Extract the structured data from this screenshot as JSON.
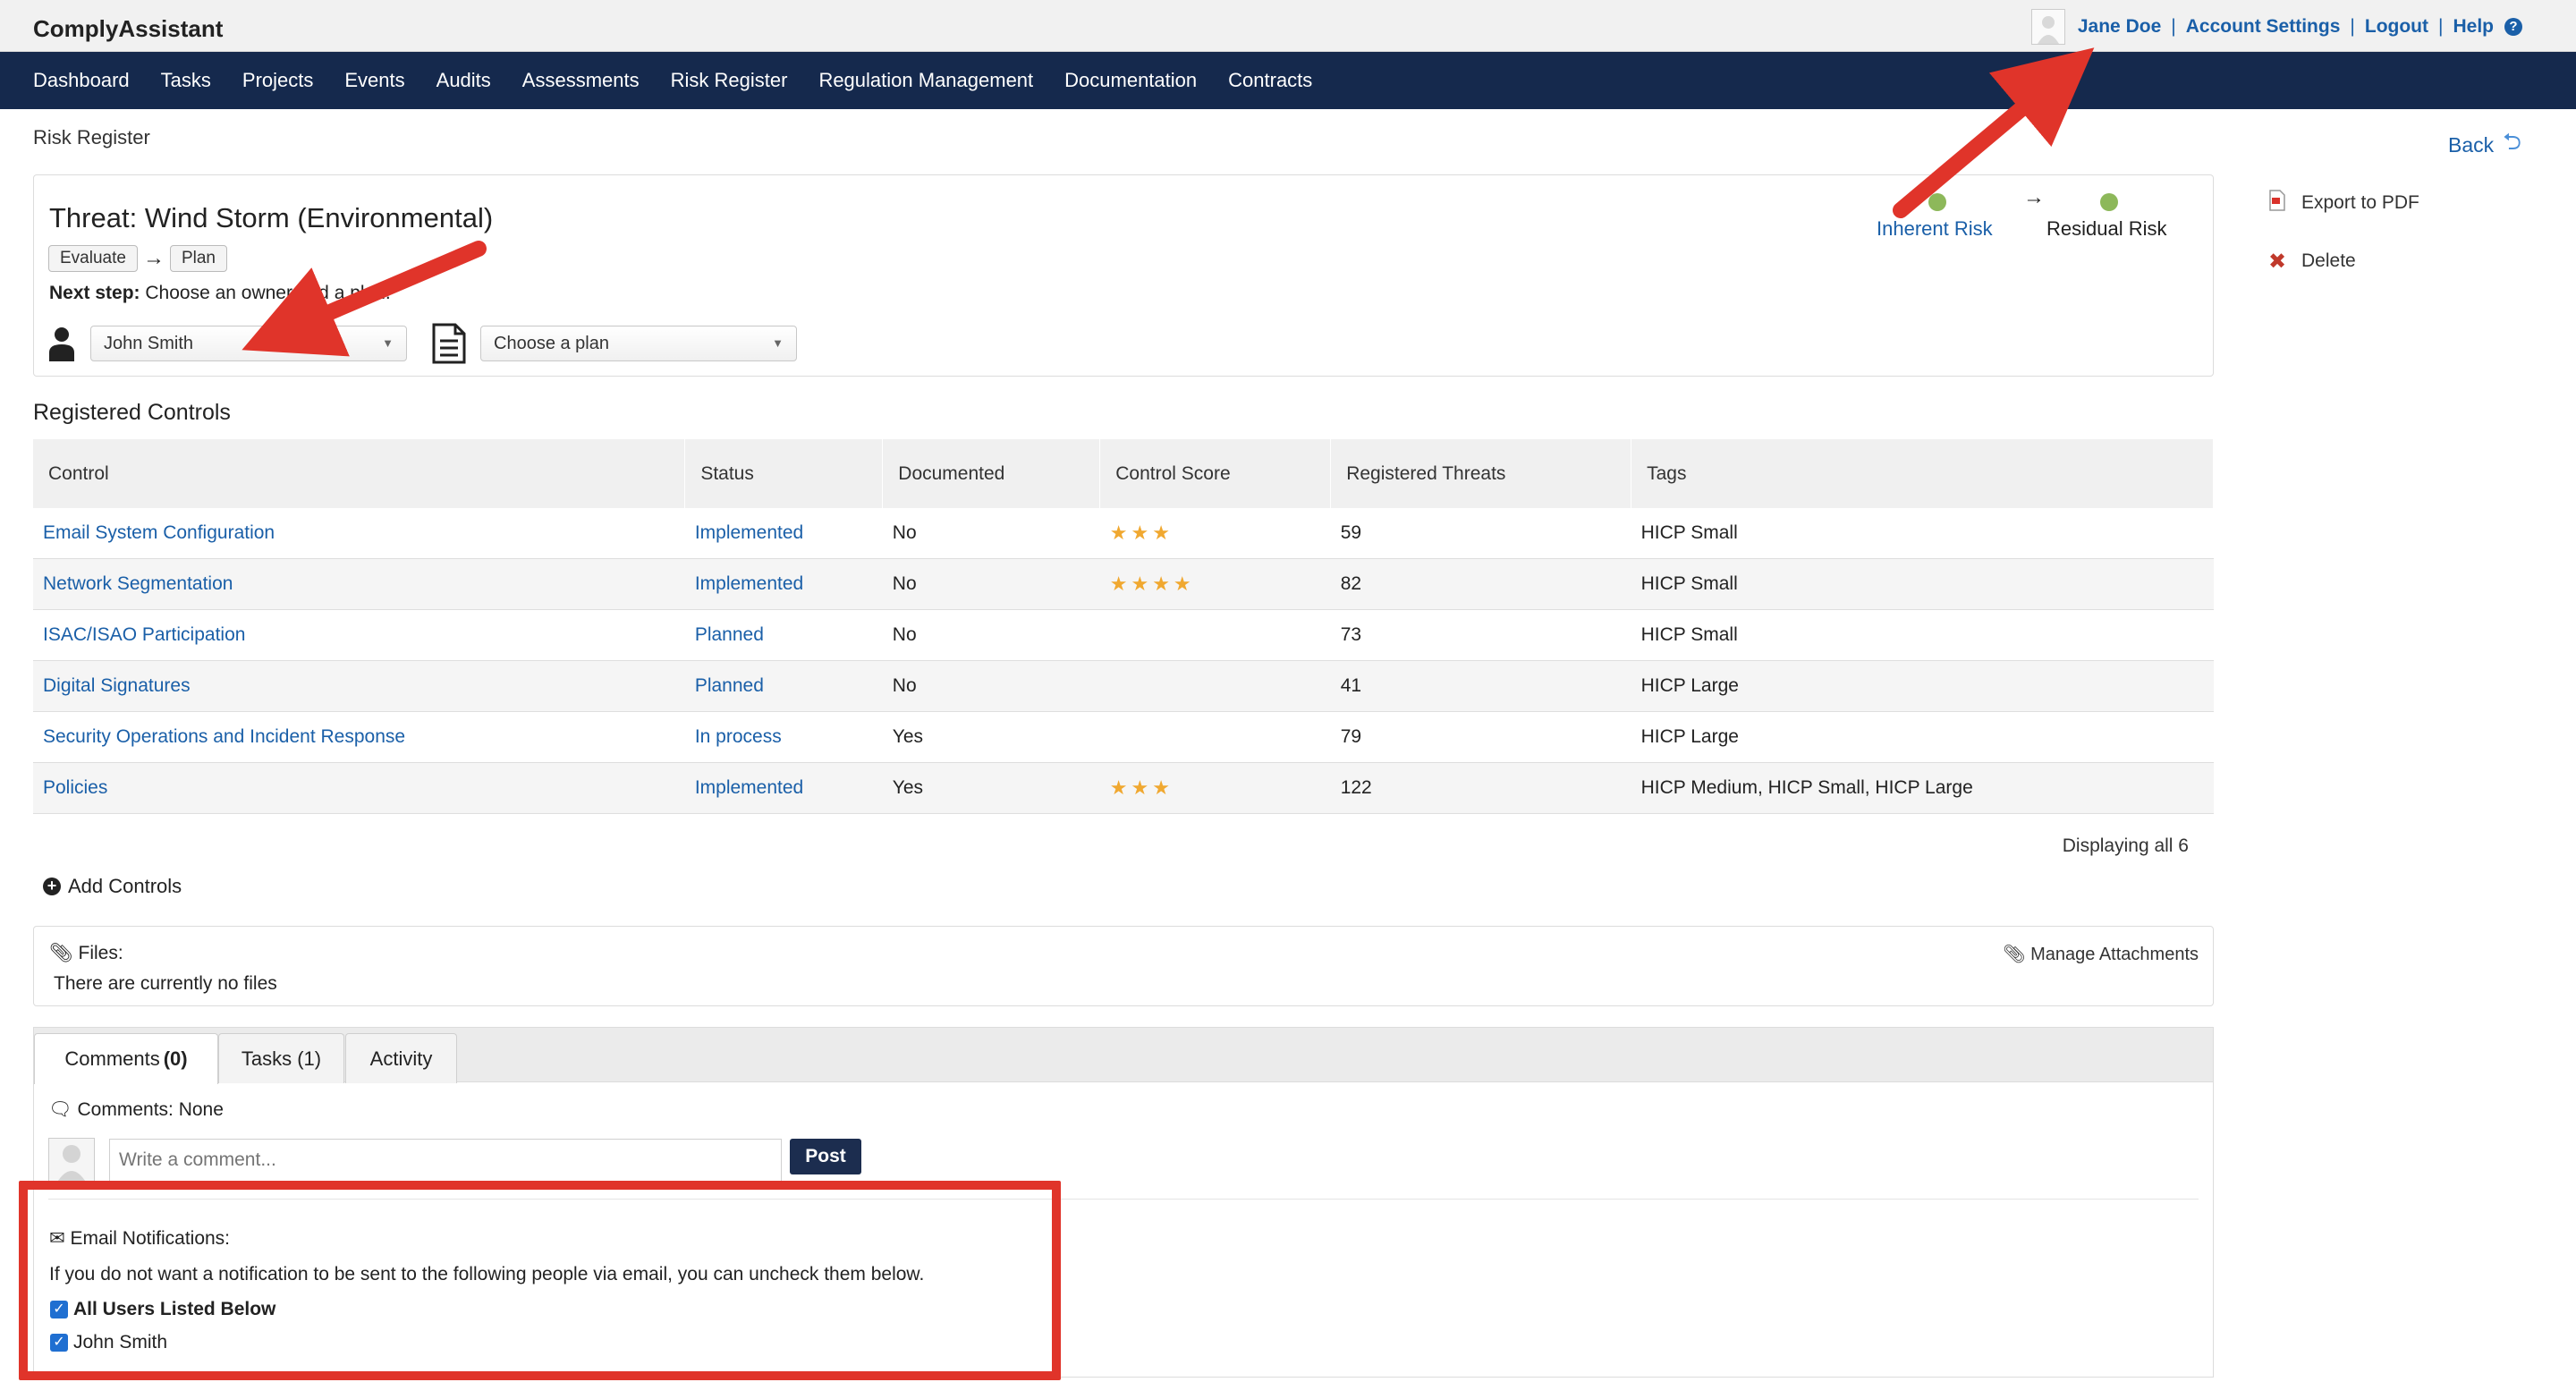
{
  "app": {
    "title": "ComplyAssistant"
  },
  "user": {
    "name": "Jane Doe",
    "links": [
      "Account Settings",
      "Logout",
      "Help"
    ]
  },
  "nav": [
    "Dashboard",
    "Tasks",
    "Projects",
    "Events",
    "Audits",
    "Assessments",
    "Risk Register",
    "Regulation Management",
    "Documentation",
    "Contracts"
  ],
  "breadcrumb": "Risk Register",
  "back_label": "Back",
  "threat": {
    "title": "Threat: Wind Storm (Environmental)",
    "steps": [
      "Evaluate",
      "Plan"
    ],
    "next_step_label": "Next step:",
    "next_step_text": "Choose an owner and a plan.",
    "owner_value": "John Smith",
    "plan_placeholder": "Choose a plan",
    "inherent_risk": "Inherent Risk",
    "residual_risk": "Residual Risk"
  },
  "side_actions": {
    "export": "Export to PDF",
    "delete": "Delete"
  },
  "controls": {
    "section_title": "Registered Controls",
    "columns": [
      "Control",
      "Status",
      "Documented",
      "Control Score",
      "Registered Threats",
      "Tags"
    ],
    "rows": [
      {
        "name": "Email System Configuration",
        "status": "Implemented",
        "documented": "No",
        "score": 3,
        "threats": "59",
        "tags": "HICP Small"
      },
      {
        "name": "Network Segmentation",
        "status": "Implemented",
        "documented": "No",
        "score": 4,
        "threats": "82",
        "tags": "HICP Small"
      },
      {
        "name": "ISAC/ISAO Participation",
        "status": "Planned",
        "documented": "No",
        "score": 0,
        "threats": "73",
        "tags": "HICP Small"
      },
      {
        "name": "Digital Signatures",
        "status": "Planned",
        "documented": "No",
        "score": 0,
        "threats": "41",
        "tags": "HICP Large"
      },
      {
        "name": "Security Operations and Incident Response",
        "status": "In process",
        "documented": "Yes",
        "score": 0,
        "threats": "79",
        "tags": "HICP Large"
      },
      {
        "name": "Policies",
        "status": "Implemented",
        "documented": "Yes",
        "score": 3,
        "threats": "122",
        "tags": "HICP Medium, HICP Small, HICP Large"
      }
    ],
    "displaying": "Displaying all 6",
    "add_label": "Add Controls"
  },
  "files": {
    "label": "Files:",
    "empty": "There are currently no files",
    "manage": "Manage Attachments"
  },
  "tabs": [
    {
      "label": "Comments",
      "count": "(0)"
    },
    {
      "label": "Tasks (1)"
    },
    {
      "label": "Activity"
    }
  ],
  "comments": {
    "label": "Comments: None",
    "placeholder": "Write a comment...",
    "post": "Post"
  },
  "notifications": {
    "title": "Email Notifications:",
    "text": "If you do not want a notification to be sent to the following people via email, you can uncheck them below.",
    "all_users": "All Users Listed Below",
    "person": "John Smith"
  },
  "colors": {
    "nav_bg": "#15294d",
    "link": "#1a5fa8",
    "annotation": "#e0342a",
    "star": "#f0a830",
    "risk_dot": "#8db85a"
  }
}
